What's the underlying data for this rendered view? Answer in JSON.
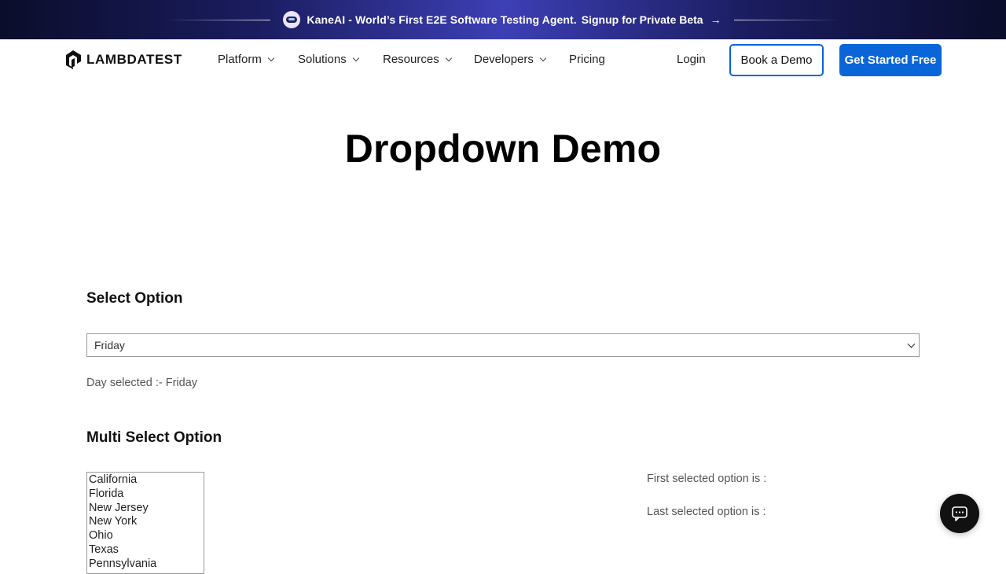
{
  "banner": {
    "text": "KaneAI - World’s First E2E Software Testing Agent.",
    "cta": "Signup for Private Beta",
    "arrow": "→"
  },
  "nav": {
    "logo_text": "LAMBDATEST",
    "items": [
      {
        "label": "Platform"
      },
      {
        "label": "Solutions"
      },
      {
        "label": "Resources"
      },
      {
        "label": "Developers"
      },
      {
        "label": "Pricing"
      }
    ],
    "login": "Login",
    "book_demo": "Book a Demo",
    "get_started": "Get Started Free"
  },
  "page": {
    "title": "Dropdown Demo"
  },
  "select_section": {
    "title": "Select Option",
    "selected_value": "Friday",
    "day_selected_text": "Day selected :- Friday"
  },
  "multi_section": {
    "title": "Multi Select Option",
    "options": [
      "California",
      "Florida",
      "New Jersey",
      "New York",
      "Ohio",
      "Texas",
      "Pennsylvania"
    ],
    "first_selected_label": "First selected option is :",
    "last_selected_label": "Last selected option is :"
  },
  "colors": {
    "accent": "#0a66d8",
    "banner_dark": "#0b0d2b",
    "banner_mid": "#3d3fb5",
    "chat_bg": "#111111"
  },
  "icons": {
    "banner": "kaneai-icon",
    "logo": "lambdatest-logo-icon",
    "chat": "chat-icon"
  }
}
